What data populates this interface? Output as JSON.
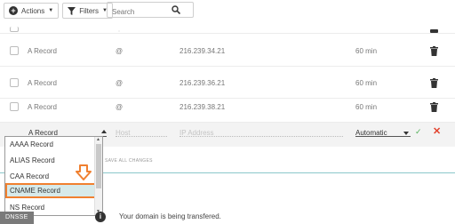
{
  "toolbar": {
    "actions_label": "Actions",
    "filters_label": "Filters",
    "search_placeholder": "Search"
  },
  "rows": [
    {
      "type": "A Record",
      "host": "@",
      "value": "216.239.34.21",
      "ttl": "60 min"
    },
    {
      "type": "A Record",
      "host": "@",
      "value": "216.239.36.21",
      "ttl": "60 min"
    },
    {
      "type": "A Record",
      "host": "@",
      "value": "216.239.38.21",
      "ttl": "60 min"
    }
  ],
  "edit_row": {
    "type_value": "A Record",
    "host_placeholder": "Host",
    "ip_placeholder": "IP Address",
    "ttl_value": "Automatic"
  },
  "save_label": "SAVE ALL CHANGES",
  "dropdown_options": [
    "AAAA Record",
    "ALIAS Record",
    "CAA Record",
    "CNAME Record",
    "NS Record"
  ],
  "selected_option_index": 3,
  "dnssec_label": "DNSSE",
  "info_icon": "i",
  "notice": "Your domain is being transfered.",
  "colors": {
    "highlight_border": "#f08030",
    "confirm": "#55b05a",
    "cancel": "#e2412c",
    "accent": "#8bc7ca"
  }
}
